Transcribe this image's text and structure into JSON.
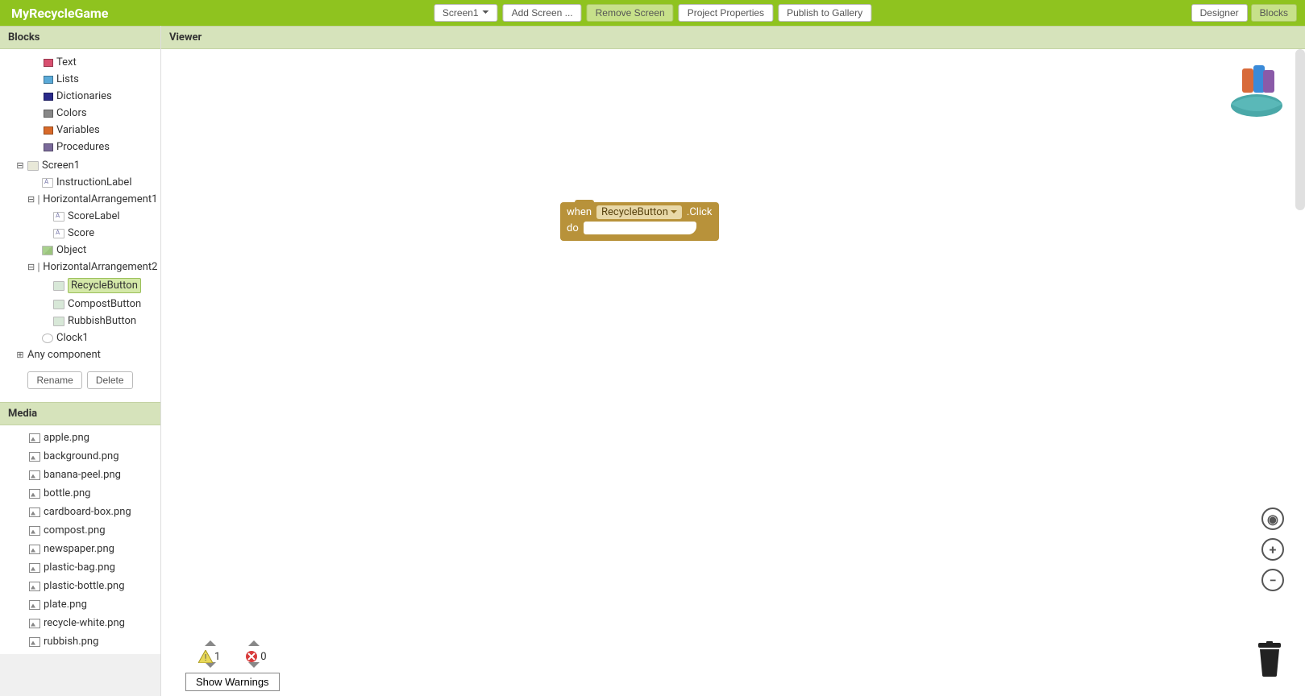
{
  "app": {
    "title": "MyRecycleGame"
  },
  "topbar": {
    "screen_dropdown": "Screen1",
    "add_screen": "Add Screen ...",
    "remove_screen": "Remove Screen",
    "project_properties": "Project Properties",
    "publish": "Publish to Gallery",
    "designer": "Designer",
    "blocks": "Blocks"
  },
  "panels": {
    "blocks": "Blocks",
    "viewer": "Viewer",
    "media": "Media"
  },
  "categories": [
    {
      "label": "Text",
      "color": "#d85070"
    },
    {
      "label": "Lists",
      "color": "#5aaad8"
    },
    {
      "label": "Dictionaries",
      "color": "#2a2a8a"
    },
    {
      "label": "Colors",
      "color": "#888888"
    },
    {
      "label": "Variables",
      "color": "#d86a2a"
    },
    {
      "label": "Procedures",
      "color": "#7a6a9a"
    }
  ],
  "components": {
    "screen": "Screen1",
    "instruction_label": "InstructionLabel",
    "h1": "HorizontalArrangement1",
    "score_label": "ScoreLabel",
    "score": "Score",
    "object": "Object",
    "h2": "HorizontalArrangement2",
    "recycle_btn": "RecycleButton",
    "compost_btn": "CompostButton",
    "rubbish_btn": "RubbishButton",
    "clock": "Clock1",
    "any_component": "Any component"
  },
  "comp_buttons": {
    "rename": "Rename",
    "delete": "Delete"
  },
  "media": [
    "apple.png",
    "background.png",
    "banana-peel.png",
    "bottle.png",
    "cardboard-box.png",
    "compost.png",
    "newspaper.png",
    "plastic-bag.png",
    "plastic-bottle.png",
    "plate.png",
    "recycle-white.png",
    "rubbish.png"
  ],
  "block": {
    "when": "when",
    "target": "RecycleButton",
    "event": ".Click",
    "do": "do"
  },
  "warnings": {
    "warn_count": "1",
    "error_count": "0",
    "show": "Show Warnings"
  }
}
